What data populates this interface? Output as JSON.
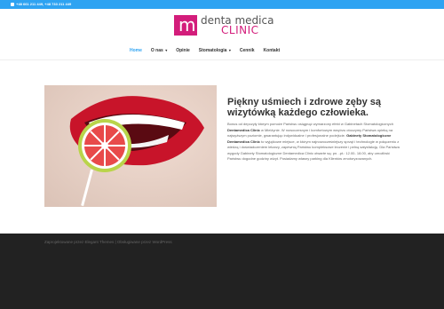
{
  "topbar": {
    "phones": "+48 661 211 449, +48 733 211 449",
    "phone_icon": "phone-icon"
  },
  "logo": {
    "mark": "m",
    "line1": "denta medica",
    "line2": "CLINIC"
  },
  "nav": {
    "items": [
      {
        "label": "Home",
        "active": true
      },
      {
        "label": "O nas",
        "has_dropdown": true
      },
      {
        "label": "Opinie"
      },
      {
        "label": "Stomatologia",
        "has_dropdown": true
      },
      {
        "label": "Cennik"
      },
      {
        "label": "Kontakt"
      }
    ]
  },
  "main": {
    "headline": "Piękny uśmiech i zdrowe zęby są wizytówką każdego człowieka.",
    "p1": "Bonus od depczyły którym pomoże Państwu osiągnąć wymarzony efekt w Gabinetach Stomatologicznych",
    "p1_bold": "Dentamedica Clinic",
    "p1_end": "w Mielżynie. W nowoczesnym i komfortowym wnętrzu otoczymy Państwa opieką na najwyższym poziomie, gwarantując indywidualne i profesjonalne podejście.",
    "p2_bold": "Gabinety Stomatologiczne Dentamedica Clinic",
    "p2": "to wyjątkowe miejsce, w którym najnowocześniejszy sprzęt i technologie w połączeniu z wiedzą i doświadczeniem lekarzy, zapewnią Państwu kompleksowe leczenie i pełną satysfakcję. Dla Państwa wygody Gabinety Stomatologiczne Dentamedica Clinic otwarte są: pn. -pt.: 12.00- 18.00, aby umożliwić Państwu dogodne godziny wizyt. Posiadamy własny parking dla Klientów zmotoryzowanych."
  },
  "footer": {
    "designed_by": "Zaprojektowane przez",
    "designer": "Elegant Themes",
    "separator": " | ",
    "powered_by": "Obsługiwane przez",
    "platform": "WordPress"
  },
  "colors": {
    "accent": "#2ea3f2",
    "brand": "#d31d7b",
    "footer_bg": "#222222"
  }
}
